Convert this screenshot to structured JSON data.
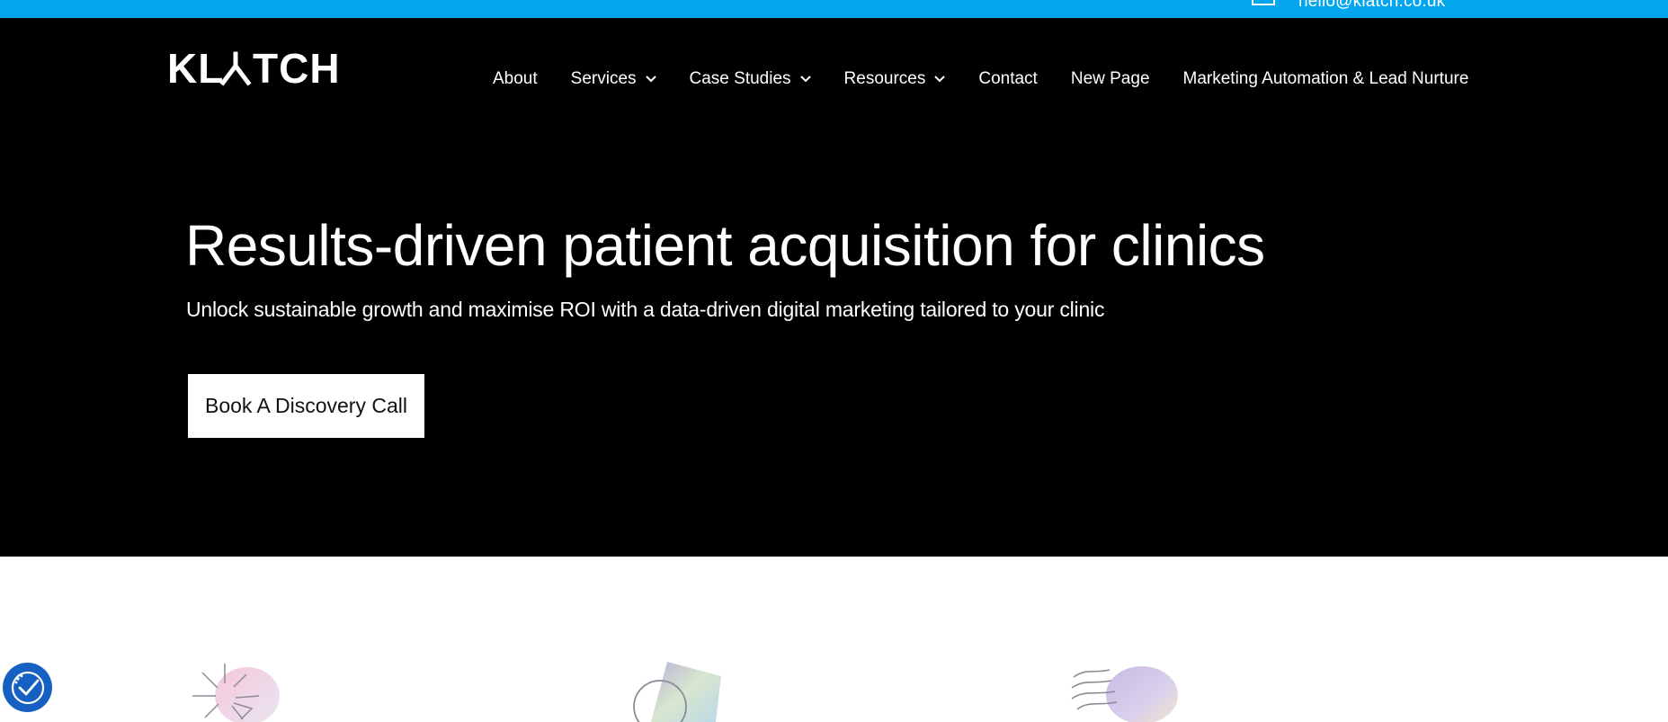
{
  "topbar": {
    "email": "hello@klatch.co.uk",
    "background": "#03a6ec",
    "icon": "mail-icon"
  },
  "header": {
    "logo_text": "KLATCH",
    "nav": [
      {
        "label": "About",
        "has_dropdown": false
      },
      {
        "label": "Services",
        "has_dropdown": true
      },
      {
        "label": "Case Studies",
        "has_dropdown": true
      },
      {
        "label": "Resources",
        "has_dropdown": true
      },
      {
        "label": "Contact",
        "has_dropdown": false
      },
      {
        "label": "New Page",
        "has_dropdown": false
      },
      {
        "label": "Marketing Automation & Lead Nurture",
        "has_dropdown": false
      }
    ]
  },
  "hero": {
    "headline": "Results-driven patient acquisition for clinics",
    "subheadline": "Unlock sustainable growth and maximise ROI with a data-driven digital marketing tailored to your clinic",
    "cta_label": "Book A Discovery Call",
    "background": "#000000"
  },
  "features": {
    "icons": [
      "sparkle-graphic",
      "shape-graphic",
      "waves-graphic"
    ]
  },
  "accessibility": {
    "icon": "accessibility-icon",
    "color": "#1660c2"
  }
}
